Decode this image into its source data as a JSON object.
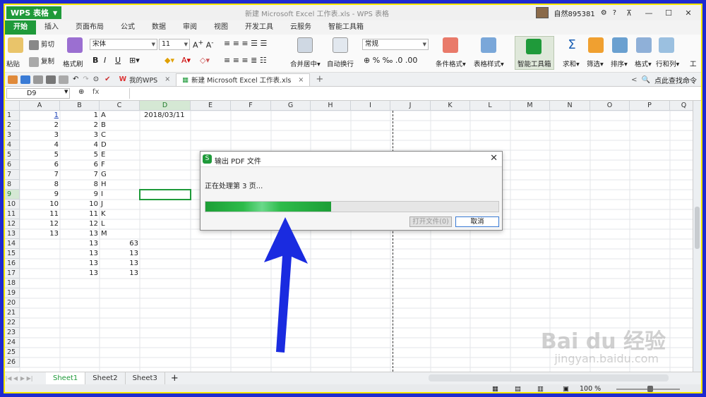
{
  "app": {
    "name": "WPS 表格",
    "window_title": "新建 Microsoft Excel 工作表.xls - WPS 表格",
    "user": "自然895381"
  },
  "menu": [
    "开始",
    "插入",
    "页面布局",
    "公式",
    "数据",
    "审阅",
    "视图",
    "开发工具",
    "云服务",
    "智能工具箱"
  ],
  "ribbon": {
    "paste": "粘贴",
    "cut": "剪切",
    "copy": "复制",
    "format_painter": "格式刷",
    "font": "宋体",
    "size": "11",
    "merge": "合并居中",
    "wrap": "自动换行",
    "number_format": "常规",
    "cond_format": "条件格式",
    "table_style": "表格样式",
    "smart_toolbox": "智能工具箱",
    "sum": "求和",
    "filter": "筛选",
    "sort": "排序",
    "format": "格式",
    "rowcol": "行和列",
    "work": "工"
  },
  "tabs": {
    "mywps": "我的WPS",
    "doc": "新建 Microsoft Excel 工作表.xls",
    "search": "点此查找命令"
  },
  "namebox": "D9",
  "fx": "fx",
  "columns": [
    "A",
    "B",
    "C",
    "D",
    "E",
    "F",
    "G",
    "H",
    "I",
    "J",
    "K",
    "L",
    "M",
    "N",
    "O",
    "P",
    "Q"
  ],
  "rows": [
    "1",
    "2",
    "3",
    "4",
    "5",
    "6",
    "7",
    "8",
    "9",
    "10",
    "11",
    "12",
    "13",
    "14",
    "15",
    "16",
    "17",
    "18",
    "19",
    "20",
    "21",
    "22",
    "23",
    "24",
    "25",
    "26"
  ],
  "cells": {
    "A": [
      "1",
      "2",
      "3",
      "4",
      "5",
      "6",
      "7",
      "8",
      "9",
      "10",
      "11",
      "12",
      "13"
    ],
    "B": [
      "1",
      "2",
      "3",
      "4",
      "5",
      "6",
      "7",
      "8",
      "9",
      "10",
      "11",
      "12",
      "13",
      "13",
      "13",
      "13",
      "13"
    ],
    "B_text": [
      "A",
      "B",
      "C",
      "D",
      "E",
      "F",
      "G",
      "H",
      "I",
      "J",
      "K",
      "L",
      "M"
    ],
    "C": [
      "63",
      "13",
      "13",
      "13"
    ],
    "D1": "2018/03/11"
  },
  "sheets": [
    "Sheet1",
    "Sheet2",
    "Sheet3"
  ],
  "status": {
    "zoom": "100 %"
  },
  "dialog": {
    "title": "输出 PDF 文件",
    "message": "正在处理第 3 页...",
    "progress": 0.43,
    "open_button": "打开文件(0)",
    "cancel_button": "取消"
  },
  "watermark": {
    "brand": "Bai du 经验",
    "url": "jingyan.baidu.com"
  },
  "colors": {
    "accent": "#1f9a3a",
    "frame": "#f5e600",
    "arrow": "#1a2be0"
  }
}
